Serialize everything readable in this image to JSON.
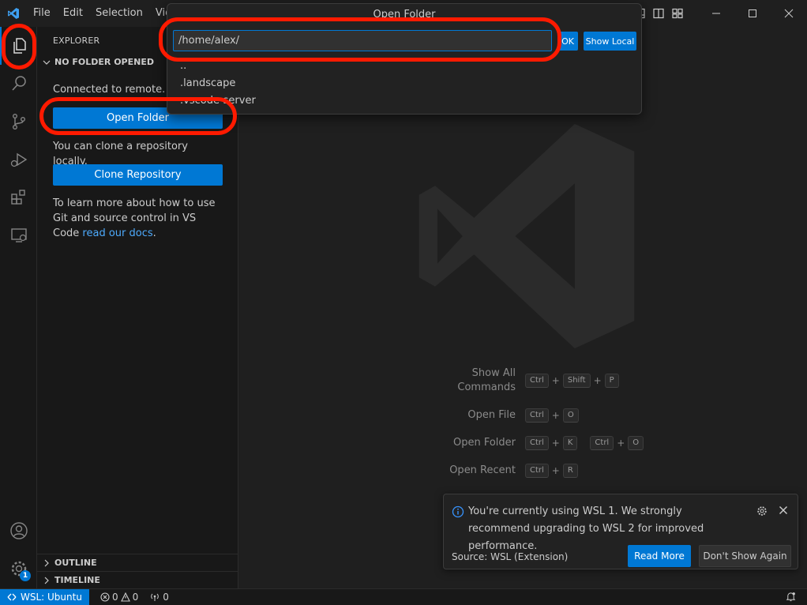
{
  "menu": [
    "File",
    "Edit",
    "Selection",
    "View"
  ],
  "sidebar": {
    "title": "EXPLORER",
    "section": "NO FOLDER OPENED",
    "connected": "Connected to remote.",
    "open_folder": "Open Folder",
    "clone_hint": "You can clone a repository locally.",
    "clone_button": "Clone Repository",
    "learn_text": "To learn more about how to use Git and source control in VS Code",
    "learn_link": "read our docs",
    "learn_end": ".",
    "outline": "OUTLINE",
    "timeline": "TIMELINE"
  },
  "quick_input": {
    "title": "Open Folder",
    "value": "/home/alex/",
    "ok": "OK",
    "show_local": "Show Local",
    "items": [
      "..",
      ".landscape",
      ".vscode-server"
    ]
  },
  "shortcuts": [
    {
      "label": "Show All\nCommands",
      "keys": [
        [
          "Ctrl",
          "Shift",
          "P"
        ]
      ]
    },
    {
      "label": "Open File",
      "keys": [
        [
          "Ctrl",
          "O"
        ]
      ]
    },
    {
      "label": "Open Folder",
      "keys": [
        [
          "Ctrl",
          "K"
        ],
        [
          "Ctrl",
          "O"
        ]
      ]
    },
    {
      "label": "Open Recent",
      "keys": [
        [
          "Ctrl",
          "R"
        ]
      ]
    }
  ],
  "notification": {
    "message": "You're currently using WSL 1. We strongly recommend upgrading to WSL 2 for improved performance.",
    "source": "Source: WSL (Extension)",
    "read_more": "Read More",
    "dont_show": "Don't Show Again"
  },
  "status": {
    "remote": "WSL: Ubuntu",
    "errors": "0",
    "warnings": "0",
    "ports": "0"
  },
  "accounts_badge": "1",
  "colors": {
    "accent": "#0078d4",
    "annotation": "#ff1a00"
  }
}
